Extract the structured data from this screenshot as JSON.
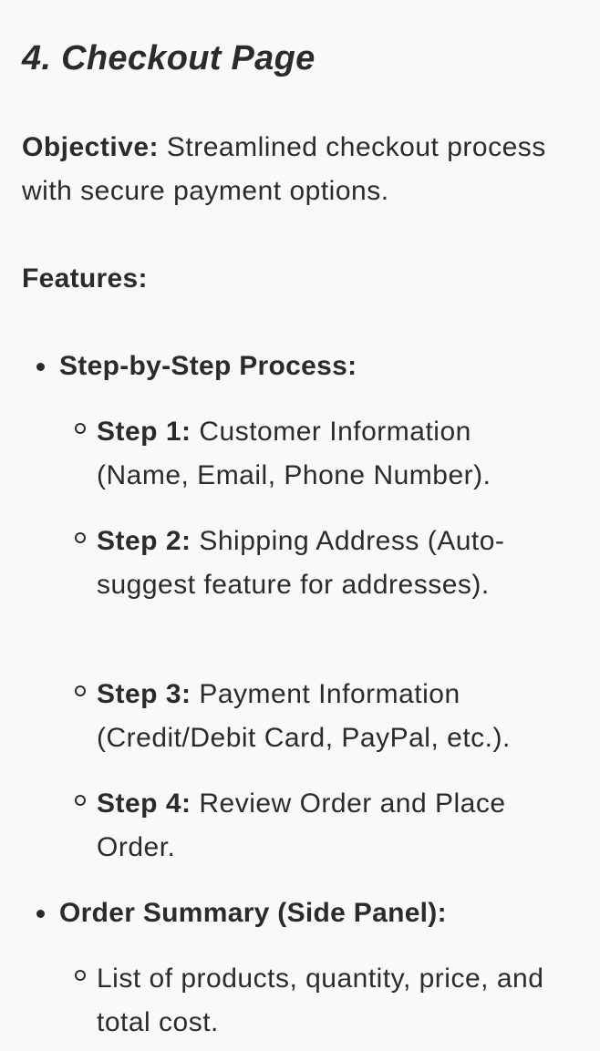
{
  "heading": "4. Checkout Page",
  "objective": {
    "label": "Objective:",
    "text": " Streamlined checkout process with secure payment options."
  },
  "features_label": "Features:",
  "features": [
    {
      "label": "Step-by-Step Process:",
      "items": [
        {
          "label": "Step 1:",
          "text": " Customer Information (Name, Email, Phone Number)."
        },
        {
          "label": "Step 2:",
          "text": " Shipping Address (Auto-suggest feature for addresses)."
        },
        {
          "label": "Step 3:",
          "text": " Payment Information (Credit/Debit Card, PayPal, etc.)."
        },
        {
          "label": "Step 4:",
          "text": " Review Order and Place Order."
        }
      ]
    },
    {
      "label": "Order Summary (Side Panel):",
      "items": [
        {
          "label": "",
          "text": "List of products, quantity, price, and total cost."
        }
      ]
    }
  ]
}
